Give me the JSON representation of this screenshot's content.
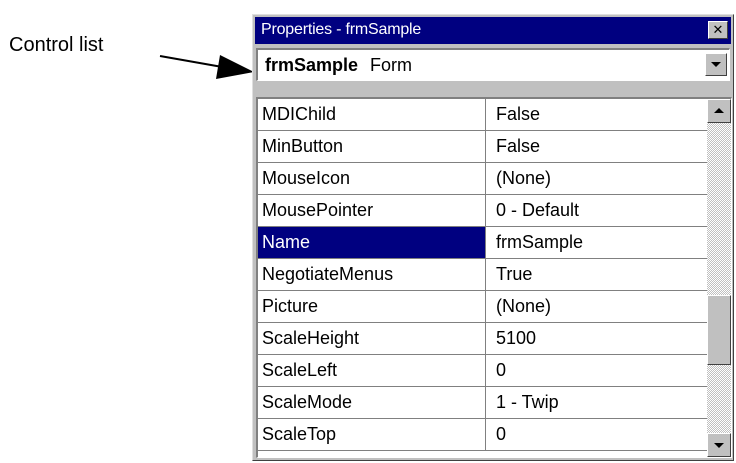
{
  "callout": {
    "label": "Control list"
  },
  "window": {
    "title": "Properties - frmSample",
    "close_glyph": "✕"
  },
  "control_list": {
    "object_name": "frmSample",
    "object_type": "Form"
  },
  "properties": [
    {
      "name": "MDIChild",
      "value": "False"
    },
    {
      "name": "MinButton",
      "value": "False"
    },
    {
      "name": "MouseIcon",
      "value": "(None)"
    },
    {
      "name": "MousePointer",
      "value": "0 - Default"
    },
    {
      "name": "Name",
      "value": "frmSample",
      "selected": true
    },
    {
      "name": "NegotiateMenus",
      "value": "True"
    },
    {
      "name": "Picture",
      "value": "(None)"
    },
    {
      "name": "ScaleHeight",
      "value": "5100"
    },
    {
      "name": "ScaleLeft",
      "value": "0"
    },
    {
      "name": "ScaleMode",
      "value": "1 - Twip"
    },
    {
      "name": "ScaleTop",
      "value": "0"
    }
  ],
  "icons": {
    "close": "close-icon",
    "dropdown": "chevron-down-icon",
    "scroll_up": "arrow-up-icon",
    "scroll_down": "arrow-down-icon"
  },
  "colors": {
    "titlebar": "#000080",
    "selection": "#000080",
    "face": "#c0c0c0"
  }
}
